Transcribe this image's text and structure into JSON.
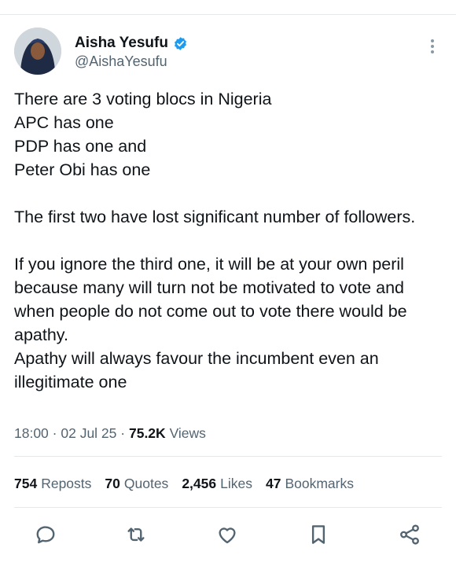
{
  "author": {
    "display_name": "Aisha Yesufu",
    "handle": "@AishaYesufu",
    "verified_badge_color": "#1d9bf0"
  },
  "tweet": {
    "text": "There are 3 voting blocs in Nigeria\nAPC has one\nPDP has one and\nPeter Obi has one\n\nThe first two have lost significant number of followers.\n\nIf you ignore the third one, it will be at your own peril because many will turn not be motivated to vote and when people do not come out to vote there would be apathy.\nApathy will always favour the incumbent even an illegitimate one",
    "time": "18:00",
    "date": "02 Jul 25",
    "separator": "·",
    "views_count": "75.2K",
    "views_label": "Views"
  },
  "stats": {
    "reposts_count": "754",
    "reposts_label": "Reposts",
    "quotes_count": "70",
    "quotes_label": "Quotes",
    "likes_count": "2,456",
    "likes_label": "Likes",
    "bookmarks_count": "47",
    "bookmarks_label": "Bookmarks"
  },
  "actions": {
    "reply_icon": "reply-icon",
    "repost_icon": "repost-icon",
    "like_icon": "heart-icon",
    "bookmark_icon": "bookmark-icon",
    "share_icon": "share-icon"
  },
  "colors": {
    "text": "#0f1419",
    "secondary": "#536471",
    "divider": "#e6e9eb",
    "icon": "#536471"
  }
}
